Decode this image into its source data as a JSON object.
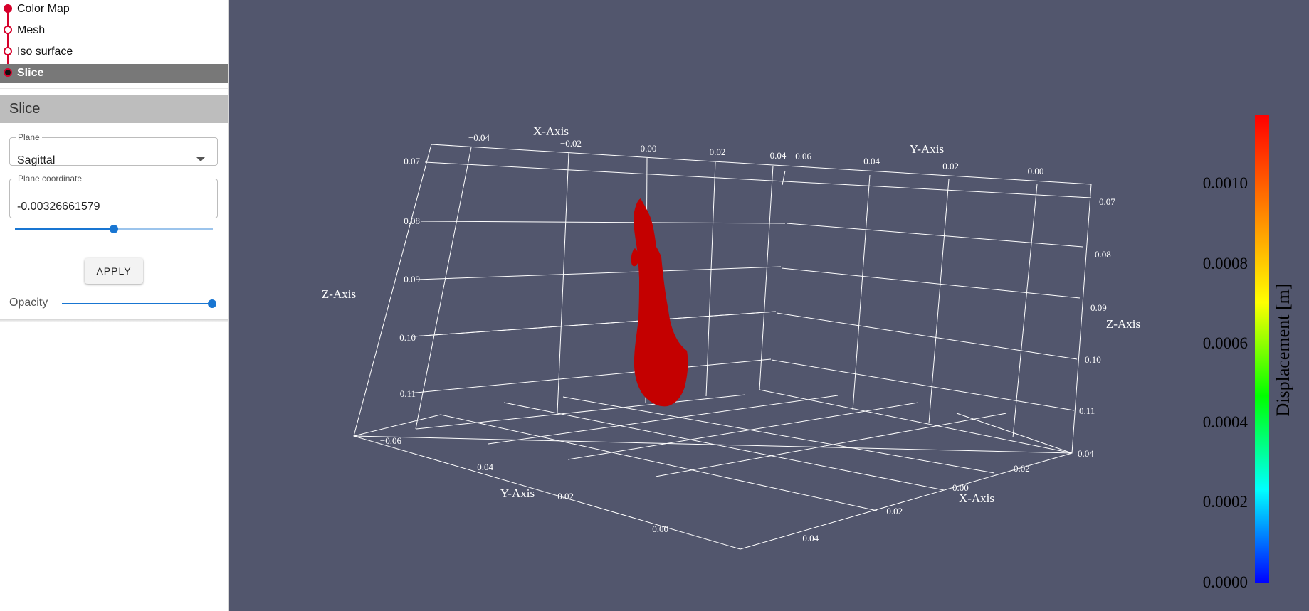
{
  "steps": [
    {
      "label": "Color Map",
      "state": "done"
    },
    {
      "label": "Mesh",
      "state": "pending"
    },
    {
      "label": "Iso surface",
      "state": "pending"
    },
    {
      "label": "Slice",
      "state": "active"
    }
  ],
  "panel": {
    "title": "Slice",
    "plane": {
      "label": "Plane",
      "value": "Sagittal"
    },
    "coordinate": {
      "label": "Plane coordinate",
      "value": "-0.00326661579",
      "slider_fraction": 0.5
    },
    "apply_label": "APPLY",
    "opacity": {
      "label": "Opacity",
      "value": 1.0
    }
  },
  "plot": {
    "x_axis_title": "X-Axis",
    "y_axis_title": "Y-Axis",
    "z_axis_title": "Z-Axis",
    "x_ticks_top": [
      "−0.04",
      "−0.02",
      "0.00",
      "0.02",
      "0.04"
    ],
    "y_ticks_top": [
      "−0.06",
      "−0.04",
      "−0.02",
      "0.00"
    ],
    "z_ticks_left": [
      "0.07",
      "0.08",
      "0.09",
      "0.10",
      "0.11"
    ],
    "z_ticks_right": [
      "0.07",
      "0.08",
      "0.09",
      "0.10",
      "0.11"
    ],
    "y_ticks_bottom": [
      "−0.06",
      "−0.04",
      "−0.02",
      "0.00"
    ],
    "x_ticks_bottom": [
      "0.04",
      "0.02",
      "0.00",
      "−0.02",
      "−0.04"
    ],
    "surface_color": "#c40000",
    "background_color": "#52566d"
  },
  "colorbar": {
    "title": "Displacement [m]",
    "ticks": [
      "0.0010",
      "0.0008",
      "0.0006",
      "0.0004",
      "0.0002",
      "0.0000"
    ],
    "range": [
      0.0,
      0.00117
    ],
    "colors": [
      "#ff0000",
      "#ff8000",
      "#ffff00",
      "#00ff00",
      "#00ffff",
      "#0000ff"
    ]
  }
}
